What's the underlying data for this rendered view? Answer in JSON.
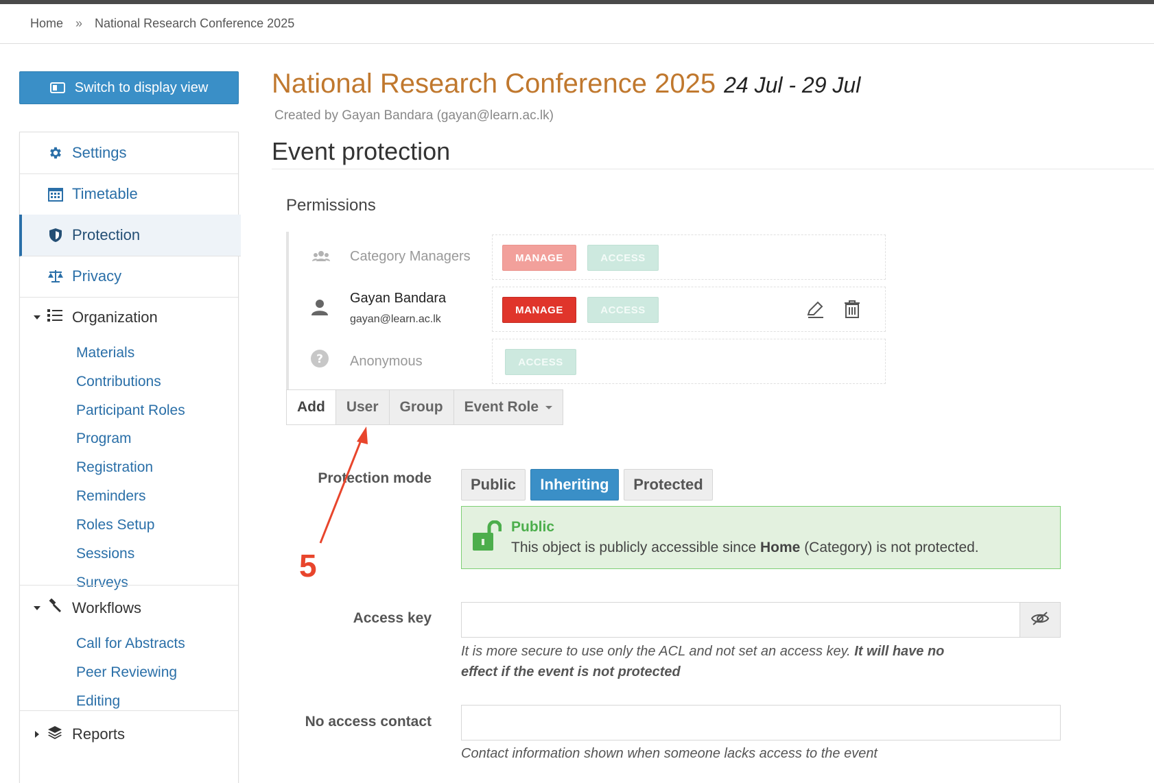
{
  "breadcrumb": {
    "home": "Home",
    "separator": "»",
    "current": "National Research Conference 2025"
  },
  "sidebar": {
    "switch_label": "Switch to display view",
    "items": [
      {
        "label": "Settings",
        "icon": "gear-icon"
      },
      {
        "label": "Timetable",
        "icon": "calendar-icon"
      },
      {
        "label": "Protection",
        "icon": "shield-icon",
        "active": true
      },
      {
        "label": "Privacy",
        "icon": "scales-icon"
      }
    ],
    "organization": {
      "label": "Organization",
      "items": [
        "Materials",
        "Contributions",
        "Participant Roles",
        "Program",
        "Registration",
        "Reminders",
        "Roles Setup",
        "Sessions",
        "Surveys"
      ]
    },
    "workflows": {
      "label": "Workflows",
      "items": [
        "Call for Abstracts",
        "Peer Reviewing",
        "Editing"
      ]
    },
    "reports": {
      "label": "Reports"
    }
  },
  "event": {
    "title": "National Research Conference 2025",
    "dates": "24 Jul - 29 Jul",
    "created_by": "Created by Gayan Bandara (gayan@learn.ac.lk)"
  },
  "page": {
    "section_title": "Event protection",
    "permissions_title": "Permissions"
  },
  "permissions": [
    {
      "name": "Category Managers",
      "roles": [
        "MANAGE",
        "ACCESS"
      ]
    },
    {
      "name": "Gayan Bandara",
      "email": "gayan@learn.ac.lk",
      "roles": [
        "MANAGE",
        "ACCESS"
      ]
    },
    {
      "name": "Anonymous",
      "roles": [
        "ACCESS"
      ]
    }
  ],
  "add_bar": {
    "label": "Add",
    "user": "User",
    "group": "Group",
    "event_role": "Event Role"
  },
  "protection": {
    "label": "Protection mode",
    "modes": [
      "Public",
      "Inheriting",
      "Protected"
    ],
    "selected": "Inheriting",
    "status_title": "Public",
    "status_text_pre": "This object is publicly accessible since ",
    "status_text_bold": "Home",
    "status_text_post": " (Category) is not protected."
  },
  "access_key": {
    "label": "Access key",
    "value": "",
    "help_normal": "It is more secure to use only the ACL and not set an access key. ",
    "help_bold": "It will have no effect if the event is not protected"
  },
  "no_access_contact": {
    "label": "No access contact",
    "value": "",
    "help": "Contact information shown when someone lacks access to the event"
  },
  "annotation": {
    "number": "5"
  },
  "colors": {
    "accent": "#3a8fc7",
    "title": "#c0782e",
    "manage": "#e0352b",
    "success": "#4cae4c",
    "annotation": "#e8452c"
  }
}
